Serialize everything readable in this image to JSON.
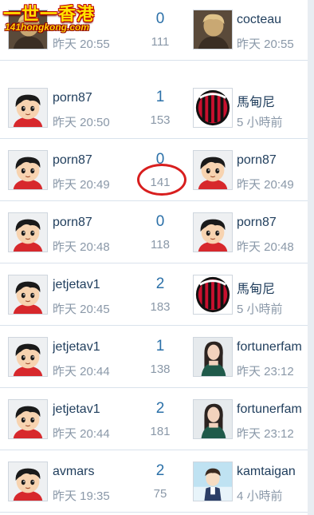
{
  "watermark": {
    "line1": "一世一香港",
    "line2": "141hongkong.com"
  },
  "threads": [
    {
      "author": "",
      "author_time": "昨天 20:55",
      "replies": "0",
      "views": "111",
      "last_user": "cocteau",
      "last_time": "昨天 20:55",
      "author_avatar": "photo-avatar-icon",
      "last_avatar": "photo-avatar-icon"
    },
    {
      "author": "porn87",
      "author_time": "昨天 20:50",
      "replies": "1",
      "views": "153",
      "last_user": "馬甸尼",
      "last_time": "5 小時前",
      "author_avatar": "cartoon-boy-avatar-icon",
      "last_avatar": "ac-milan-badge-icon"
    },
    {
      "author": "porn87",
      "author_time": "昨天 20:49",
      "replies": "0",
      "views": "141",
      "last_user": "porn87",
      "last_time": "昨天 20:49",
      "author_avatar": "cartoon-boy-avatar-icon",
      "last_avatar": "cartoon-boy-avatar-icon"
    },
    {
      "author": "porn87",
      "author_time": "昨天 20:48",
      "replies": "0",
      "views": "118",
      "last_user": "porn87",
      "last_time": "昨天 20:48",
      "author_avatar": "cartoon-boy-avatar-icon",
      "last_avatar": "cartoon-boy-avatar-icon"
    },
    {
      "author": "jetjetav1",
      "author_time": "昨天 20:45",
      "replies": "2",
      "views": "183",
      "last_user": "馬甸尼",
      "last_time": "5 小時前",
      "author_avatar": "cartoon-boy-avatar-icon",
      "last_avatar": "ac-milan-badge-icon"
    },
    {
      "author": "jetjetav1",
      "author_time": "昨天 20:44",
      "replies": "1",
      "views": "138",
      "last_user": "fortunerfam",
      "last_time": "昨天 23:12",
      "author_avatar": "cartoon-boy-avatar-icon",
      "last_avatar": "photo-avatar-icon"
    },
    {
      "author": "jetjetav1",
      "author_time": "昨天 20:44",
      "replies": "2",
      "views": "181",
      "last_user": "fortunerfam",
      "last_time": "昨天 23:12",
      "author_avatar": "cartoon-boy-avatar-icon",
      "last_avatar": "photo-avatar-icon"
    },
    {
      "author": "avmars",
      "author_time": "昨天 19:35",
      "replies": "2",
      "views": "75",
      "last_user": "kamtaigan",
      "last_time": "4 小時前",
      "author_avatar": "cartoon-boy-avatar-icon",
      "last_avatar": "cartoon-character-avatar-icon"
    }
  ]
}
